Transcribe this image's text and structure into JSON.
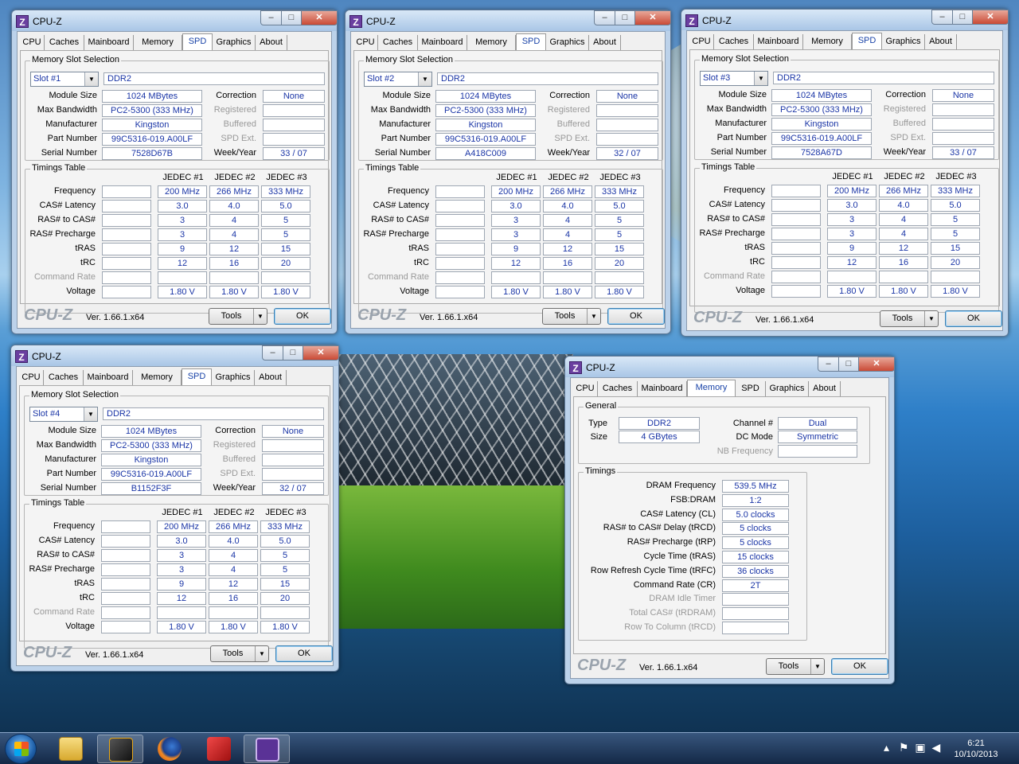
{
  "app_title": "CPU-Z",
  "tabs": [
    "CPU",
    "Caches",
    "Mainboard",
    "Memory",
    "SPD",
    "Graphics",
    "About"
  ],
  "spd_labels": {
    "group": "Memory Slot Selection",
    "module_size": "Module Size",
    "max_bandwidth": "Max Bandwidth",
    "manufacturer": "Manufacturer",
    "part_number": "Part Number",
    "serial_number": "Serial Number",
    "correction": "Correction",
    "registered": "Registered",
    "buffered": "Buffered",
    "spd_ext": "SPD Ext.",
    "week_year": "Week/Year",
    "timings_group": "Timings Table"
  },
  "timing_rows": [
    "Frequency",
    "CAS# Latency",
    "RAS# to CAS#",
    "RAS# Precharge",
    "tRAS",
    "tRC",
    "Command Rate",
    "Voltage"
  ],
  "jedec_headers": [
    "JEDEC #1",
    "JEDEC #2",
    "JEDEC #3"
  ],
  "jedec_values": [
    [
      "200 MHz",
      "266 MHz",
      "333 MHz"
    ],
    [
      "3.0",
      "4.0",
      "5.0"
    ],
    [
      "3",
      "4",
      "5"
    ],
    [
      "3",
      "4",
      "5"
    ],
    [
      "9",
      "12",
      "15"
    ],
    [
      "12",
      "16",
      "20"
    ],
    [
      "",
      "",
      ""
    ],
    [
      "1.80 V",
      "1.80 V",
      "1.80 V"
    ]
  ],
  "footer": {
    "brand": "CPU-Z",
    "version": "Ver. 1.66.1.x64",
    "tools": "Tools",
    "ok": "OK"
  },
  "slots": [
    {
      "slot": "Slot #1",
      "type": "DDR2",
      "module_size": "1024 MBytes",
      "max_bandwidth": "PC2-5300 (333 MHz)",
      "manufacturer": "Kingston",
      "part_number": "99C5316-019.A00LF",
      "serial_number": "7528D67B",
      "correction": "None",
      "week_year": "33 / 07"
    },
    {
      "slot": "Slot #2",
      "type": "DDR2",
      "module_size": "1024 MBytes",
      "max_bandwidth": "PC2-5300 (333 MHz)",
      "manufacturer": "Kingston",
      "part_number": "99C5316-019.A00LF",
      "serial_number": "A418C009",
      "correction": "None",
      "week_year": "32 / 07"
    },
    {
      "slot": "Slot #3",
      "type": "DDR2",
      "module_size": "1024 MBytes",
      "max_bandwidth": "PC2-5300 (333 MHz)",
      "manufacturer": "Kingston",
      "part_number": "99C5316-019.A00LF",
      "serial_number": "7528A67D",
      "correction": "None",
      "week_year": "33 / 07"
    },
    {
      "slot": "Slot #4",
      "type": "DDR2",
      "module_size": "1024 MBytes",
      "max_bandwidth": "PC2-5300 (333 MHz)",
      "manufacturer": "Kingston",
      "part_number": "99C5316-019.A00LF",
      "serial_number": "B1152F3F",
      "correction": "None",
      "week_year": "32 / 07"
    }
  ],
  "memory": {
    "general_label": "General",
    "type_label": "Type",
    "type": "DDR2",
    "size_label": "Size",
    "size": "4 GBytes",
    "channel_label": "Channel #",
    "channel": "Dual",
    "dcmode_label": "DC Mode",
    "dcmode": "Symmetric",
    "nbfreq_label": "NB Frequency",
    "nbfreq": "",
    "timings_label": "Timings",
    "rows": [
      {
        "label": "DRAM Frequency",
        "value": "539.5 MHz",
        "dim": false
      },
      {
        "label": "FSB:DRAM",
        "value": "1:2",
        "dim": false
      },
      {
        "label": "CAS# Latency (CL)",
        "value": "5.0 clocks",
        "dim": false
      },
      {
        "label": "RAS# to CAS# Delay (tRCD)",
        "value": "5 clocks",
        "dim": false
      },
      {
        "label": "RAS# Precharge (tRP)",
        "value": "5 clocks",
        "dim": false
      },
      {
        "label": "Cycle Time (tRAS)",
        "value": "15 clocks",
        "dim": false
      },
      {
        "label": "Row Refresh Cycle Time (tRFC)",
        "value": "36 clocks",
        "dim": false
      },
      {
        "label": "Command Rate (CR)",
        "value": "2T",
        "dim": false
      },
      {
        "label": "DRAM Idle Timer",
        "value": "",
        "dim": true
      },
      {
        "label": "Total CAS# (tRDRAM)",
        "value": "",
        "dim": true
      },
      {
        "label": "Row To Column (tRCD)",
        "value": "",
        "dim": true
      }
    ]
  },
  "taskbar": {
    "time": "6:21",
    "date": "10/10/2013"
  }
}
